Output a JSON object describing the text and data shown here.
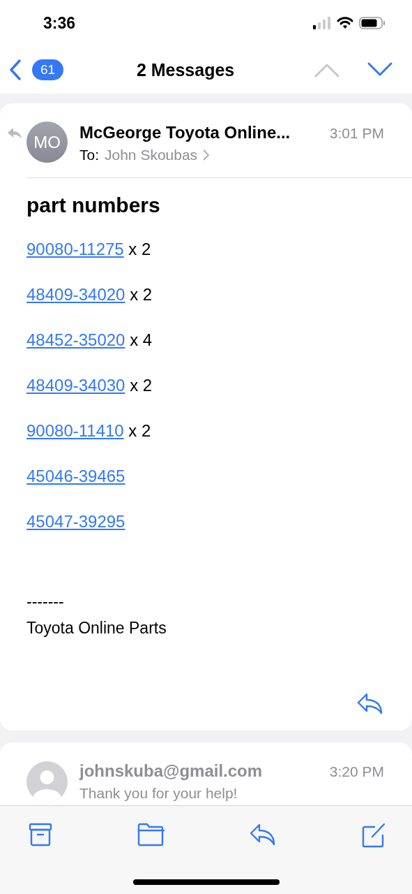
{
  "status_bar": {
    "time": "3:36"
  },
  "nav_bar": {
    "back_count": "61",
    "title": "2 Messages",
    "previous": {
      "disabled": true
    },
    "next": {
      "disabled": false
    }
  },
  "messages": [
    {
      "avatar_initials": "MO",
      "replied": true,
      "sender": "McGeorge Toyota Online...",
      "time": "3:01 PM",
      "to_label": "To:",
      "recipient": "John Skoubas",
      "subject": "part numbers",
      "lines": [
        {
          "part": "90080-11275",
          "quantity": "x 2"
        },
        {
          "part": "48409-34020",
          "quantity": "x 2"
        },
        {
          "part": "48452-35020",
          "quantity": "x 4"
        },
        {
          "part": "48409-34030",
          "quantity": "x 2"
        },
        {
          "part": "90080-11410",
          "quantity": "x 2"
        },
        {
          "part": "45046-39465"
        },
        {
          "part": "45047-39295"
        }
      ],
      "signature": [
        "-------",
        "Toyota Online Parts"
      ]
    },
    {
      "sender": "johnskuba@gmail.com",
      "time": "3:20 PM",
      "preview": "Thank you for your help!"
    }
  ]
}
